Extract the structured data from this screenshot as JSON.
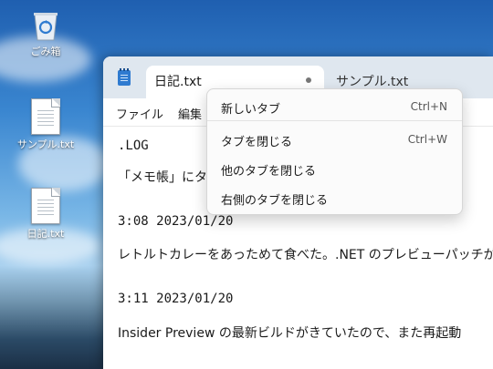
{
  "desktop": {
    "icons": [
      {
        "label": "ごみ箱",
        "icon": "recycle-bin-icon"
      },
      {
        "label": "サンプル.txt",
        "icon": "text-file-icon"
      },
      {
        "label": "日記.txt",
        "icon": "text-file-icon"
      }
    ]
  },
  "notepad": {
    "tabs": [
      {
        "label": "日記.txt",
        "state": "active, unsaved"
      },
      {
        "label": "サンプル.txt"
      }
    ],
    "menu": {
      "file": "ファイル",
      "edit": "編集"
    },
    "content": [
      ".LOG",
      "「メモ帳」にタブが",
      "3:08 2023/01/20",
      "レトルトカレーをあっためて食べた。.NET のプレビューパッチが降ってき",
      "3:11 2023/01/20",
      "Insider Preview の最新ビルドがきていたので、また再起動"
    ]
  },
  "context_menu": {
    "items": [
      {
        "label": "新しいタブ",
        "shortcut": "Ctrl+N"
      },
      {
        "label": "タブを閉じる",
        "shortcut": "Ctrl+W"
      },
      {
        "label": "他のタブを閉じる",
        "shortcut": ""
      },
      {
        "label": "右側のタブを閉じる",
        "shortcut": ""
      }
    ]
  },
  "colors": {
    "accent": "#2f7bd0",
    "tabbar": "#dfe7ef"
  }
}
